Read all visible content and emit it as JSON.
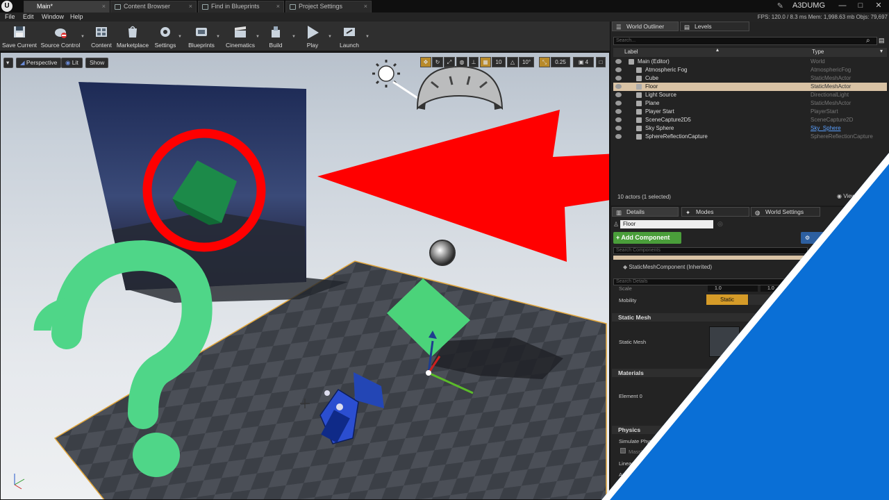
{
  "titlebar": {
    "tabs": [
      "Main*",
      "Content Browser",
      "Find in Blueprints",
      "Project Settings"
    ],
    "project_name": "A3DUMG",
    "logo": "U"
  },
  "menubar": {
    "items": [
      "File",
      "Edit",
      "Window",
      "Help"
    ],
    "stats": "FPS: 120.0  /  8.3 ms    Mem: 1,998.63 mb    Objs: 79,697"
  },
  "toolbar": {
    "buttons": [
      "Save Current",
      "Source Control",
      "Content",
      "Marketplace",
      "Settings",
      "Blueprints",
      "Cinematics",
      "Build",
      "Play",
      "Launch"
    ]
  },
  "viewport": {
    "perspective_label": "Perspective",
    "lit_label": "Lit",
    "show_label": "Show",
    "grid_snap": "10",
    "rot_snap": "10°",
    "scale_snap": "0.25",
    "camera_speed": "4"
  },
  "outliner": {
    "tab_label": "World Outliner",
    "levels_label": "Levels",
    "search_placeholder": "Search...",
    "col_label": "Label",
    "col_type": "Type",
    "rows": [
      {
        "name": "Main (Editor)",
        "type": "World"
      },
      {
        "name": "Atmospheric Fog",
        "type": "AtmosphericFog"
      },
      {
        "name": "Cube",
        "type": "StaticMeshActor"
      },
      {
        "name": "Floor",
        "type": "StaticMeshActor"
      },
      {
        "name": "Light Source",
        "type": "DirectionalLight"
      },
      {
        "name": "Plane",
        "type": "StaticMeshActor"
      },
      {
        "name": "Player Start",
        "type": "PlayerStart"
      },
      {
        "name": "SceneCapture2D5",
        "type": "SceneCapture2D"
      },
      {
        "name": "Sky Sphere",
        "type": "Sky_Sphere"
      },
      {
        "name": "SphereReflectionCapture",
        "type": "SphereReflectionCapture"
      }
    ],
    "actors_count": "10 actors (1 selected)",
    "view_options": "View Options"
  },
  "details": {
    "tab_details": "Details",
    "tab_modes": "Modes",
    "tab_world_settings": "World Settings",
    "actor_name": "Floor",
    "add_component": "+ Add Component",
    "search_components": "Search Components",
    "component_inherited": "StaticMeshComponent (Inherited)",
    "search_details": "Search Details",
    "scale_label": "Scale",
    "scale_value": "1.0",
    "mobility_label": "Mobility",
    "mobility_value": "Static",
    "sec_static_mesh": "Static Mesh",
    "static_mesh_label": "Static Mesh",
    "sec_materials": "Materials",
    "element_label": "Element 0",
    "sec_physics": "Physics",
    "simulate_physics": "Simulate Physics",
    "mass": "MassInKg",
    "linear_damping": "Linear Damping",
    "angular_damping": "Angular Damping"
  },
  "colors": {
    "accent_red": "#ff0000",
    "question_green": "#4fd688",
    "accent_blue": "#0a6fd6",
    "selected_row": "#d9c3a5"
  }
}
